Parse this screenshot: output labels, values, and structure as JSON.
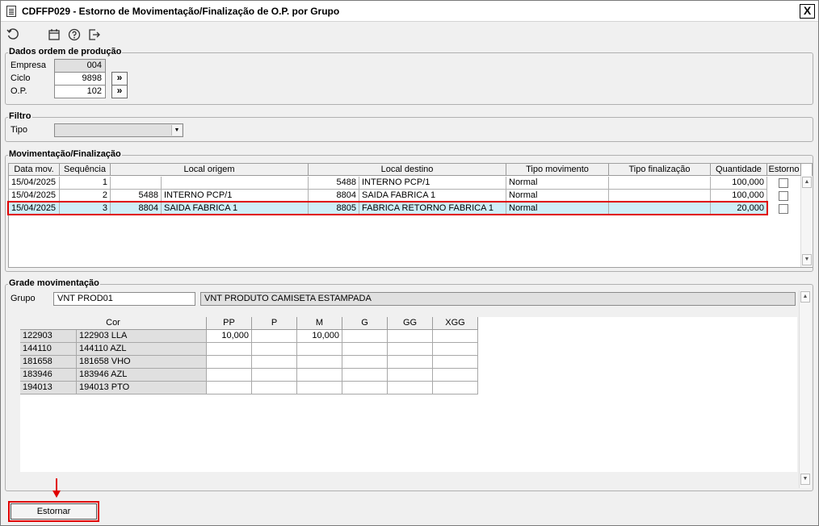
{
  "window": {
    "title": "CDFFP029 - Estorno de Movimentação/Finalização de O.P. por Grupo",
    "close_label": "X"
  },
  "toolbar": {
    "icons": [
      "refresh-icon",
      "calendar-icon",
      "help-icon",
      "exit-icon"
    ]
  },
  "dados": {
    "legend": "Dados ordem de produção",
    "empresa_label": "Empresa",
    "empresa_value": "004",
    "ciclo_label": "Ciclo",
    "ciclo_value": "9898",
    "op_label": "O.P.",
    "op_value": "102",
    "go_label": "»"
  },
  "filtro": {
    "legend": "Filtro",
    "tipo_label": "Tipo",
    "tipo_value": ""
  },
  "movimentacao": {
    "legend": "Movimentação/Finalização",
    "columns": [
      "Data mov.",
      "Sequência",
      "Local origem",
      "Local destino",
      "Tipo movimento",
      "Tipo finalização",
      "Quantidade",
      "Estorno"
    ],
    "rows": [
      {
        "data": "15/04/2025",
        "seq": "1",
        "orig_cod": "",
        "orig_nome": "",
        "dest_cod": "5488",
        "dest_nome": "INTERNO PCP/1",
        "tipo_mov": "Normal",
        "tipo_fin": "",
        "qtd": "100,000"
      },
      {
        "data": "15/04/2025",
        "seq": "2",
        "orig_cod": "5488",
        "orig_nome": "INTERNO PCP/1",
        "dest_cod": "8804",
        "dest_nome": "SAIDA FABRICA 1",
        "tipo_mov": "Normal",
        "tipo_fin": "",
        "qtd": "100,000"
      },
      {
        "data": "15/04/2025",
        "seq": "3",
        "orig_cod": "8804",
        "orig_nome": "SAIDA FABRICA 1",
        "dest_cod": "8805",
        "dest_nome": "FABRICA RETORNO FABRICA 1",
        "tipo_mov": "Normal",
        "tipo_fin": "",
        "qtd": "20,000"
      }
    ]
  },
  "grade": {
    "legend": "Grade movimentação",
    "grupo_label": "Grupo",
    "grupo_value": "VNT PROD01",
    "grupo_desc": "VNT PRODUTO CAMISETA ESTAMPADA",
    "cor_header": "Cor",
    "sizes": [
      "PP",
      "P",
      "M",
      "G",
      "GG",
      "XGG"
    ],
    "rows": [
      {
        "cod": "122903",
        "nome": "122903 LLA",
        "vals": [
          "10,000",
          "",
          "10,000",
          "",
          "",
          ""
        ]
      },
      {
        "cod": "144110",
        "nome": "144110 AZL",
        "vals": [
          "",
          "",
          "",
          "",
          "",
          ""
        ]
      },
      {
        "cod": "181658",
        "nome": "181658 VHO",
        "vals": [
          "",
          "",
          "",
          "",
          "",
          ""
        ]
      },
      {
        "cod": "183946",
        "nome": "183946 AZL",
        "vals": [
          "",
          "",
          "",
          "",
          "",
          ""
        ]
      },
      {
        "cod": "194013",
        "nome": "194013 PTO",
        "vals": [
          "",
          "",
          "",
          "",
          "",
          ""
        ]
      }
    ]
  },
  "actions": {
    "estornar_label": "Estornar"
  },
  "colors": {
    "highlight": "#e00000",
    "selected_row": "#cfeef8",
    "readonly": "#e0e0e0"
  }
}
